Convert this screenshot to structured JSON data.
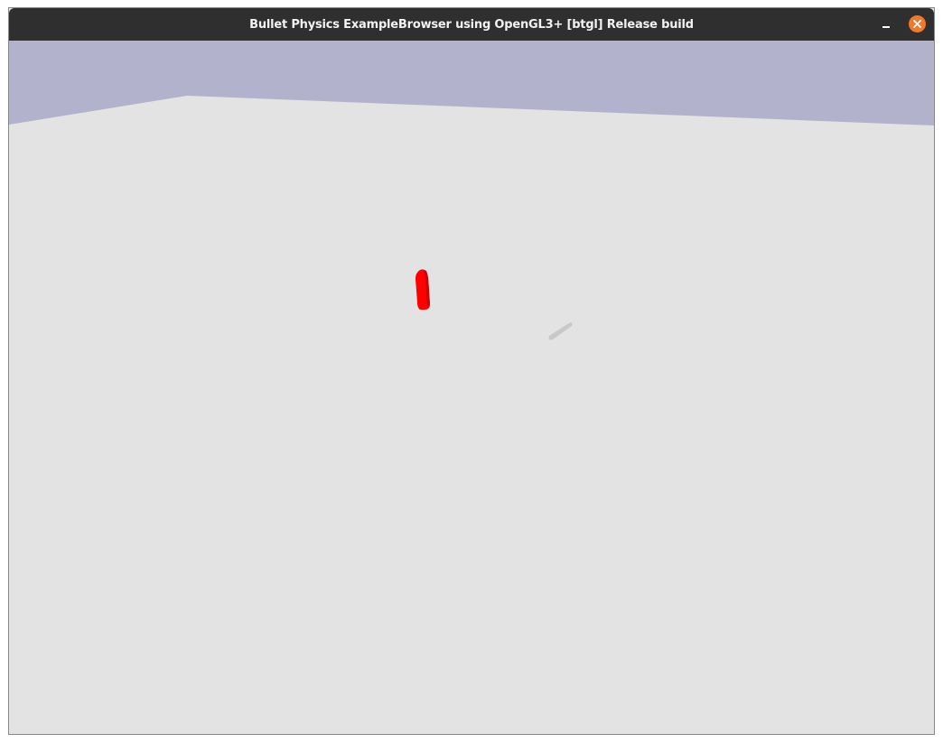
{
  "window": {
    "title": "Bullet Physics ExampleBrowser using OpenGL3+ [btgl] Release build",
    "controls": {
      "minimize_icon": "minimize-icon",
      "close_icon": "close-icon"
    }
  },
  "scene": {
    "sky_color": "#b2b2cc",
    "ground_color": "#e3e3e3",
    "objects": [
      {
        "kind": "box",
        "color": "#ff0000"
      },
      {
        "kind": "capsule",
        "color": "#c8c8c8"
      }
    ]
  },
  "colors": {
    "titlebar": "#2f2f2f",
    "title_text": "#f2f2f2",
    "close_accent": "#ee7a2a"
  }
}
